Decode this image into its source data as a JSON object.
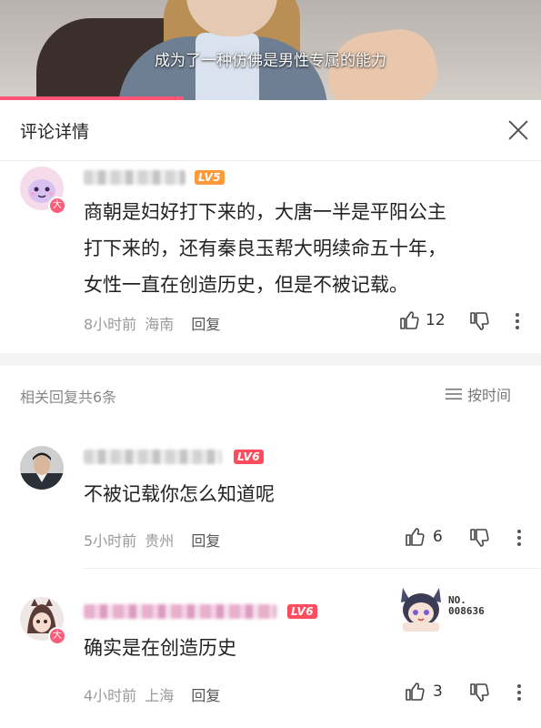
{
  "video": {
    "subtitle": "成为了一种仿佛是男性专属的能力",
    "progress_fraction": 0.34
  },
  "header": {
    "title": "评论详情"
  },
  "main_comment": {
    "level": "LV5",
    "avatar_badge": "大",
    "lines": [
      "商朝是妇好打下来的，大唐一半是平阳公主",
      "打下来的，还有秦良玉帮大明续命五十年，",
      "女性一直在创造历史，但是不被记载。"
    ],
    "time": "8小时前",
    "location": "海南",
    "reply_label": "回复",
    "likes": "12"
  },
  "related": {
    "label": "相关回复共6条",
    "sort_label": "按时间"
  },
  "replies": [
    {
      "level": "LV6",
      "text": "不被记载你怎么知道呢",
      "time": "5小时前",
      "location": "贵州",
      "reply_label": "回复",
      "likes": "6"
    },
    {
      "level": "LV6",
      "avatar_badge": "大",
      "text": "确实是在创造历史",
      "time": "4小时前",
      "location": "上海",
      "reply_label": "回复",
      "likes": "3"
    }
  ],
  "sticker": {
    "line1": "NO.",
    "line2": "008636"
  },
  "colors": {
    "lv5": "#ff9a3c",
    "lv6": "#ff4d5e",
    "badge": "#ff5c7c",
    "progress": "#ff5577"
  }
}
